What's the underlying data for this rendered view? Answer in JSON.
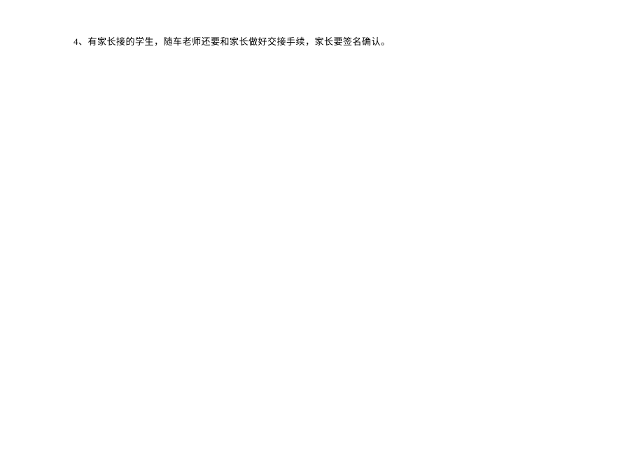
{
  "document": {
    "paragraphs": [
      {
        "text": "4、有家长接的学生，随车老师还要和家长做好交接手续，家长要签名确认。"
      }
    ]
  }
}
